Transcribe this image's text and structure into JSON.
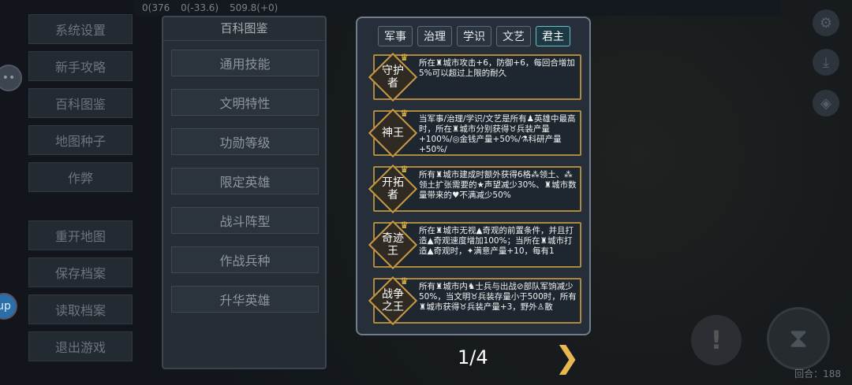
{
  "topbar": {
    "stat1": "0(376",
    "stat2": "0(-33.6)",
    "stat3": "509.8(+0)"
  },
  "left_menu": {
    "group1": [
      "系统设置",
      "新手攻略",
      "百科图鉴",
      "地图种子",
      "作弊"
    ],
    "group2": [
      "重开地图",
      "保存档案",
      "读取档案",
      "退出游戏"
    ]
  },
  "side_badge": "up",
  "encyclopedia": {
    "title": "百科图鉴",
    "items": [
      "通用技能",
      "文明特性",
      "功勋等级",
      "限定英雄",
      "战斗阵型",
      "作战兵种",
      "升华英雄"
    ]
  },
  "card": {
    "tabs": [
      "军事",
      "治理",
      "学识",
      "文艺",
      "君主"
    ],
    "active_tab": "君主",
    "traits": [
      {
        "name": "守护者",
        "desc": "所在♜城市攻击+6，防御+6，每回合增加5%可以超过上限的耐久"
      },
      {
        "name": "神王",
        "desc": "当军事/治理/学识/文艺是所有♟英雄中最高时，所在♜城市分别获得♉兵装产量+100%/◎金钱产量+50%/⚗科研产量+50%/"
      },
      {
        "name": "开拓者",
        "desc": "所有♜城市建成时额外获得6格⁂领土、⁂领土扩张需要的★声望减少30%、♜城市数量带来的♥不满减少50%"
      },
      {
        "name": "奇迹王",
        "desc": "所在♜城市无视▲奇观的前置条件，并且打造▲奇观速度增加100%；当所在♜城市打造▲奇观时，✦满意产量+10，每有1"
      },
      {
        "name": "战争之王",
        "desc": "所有♜城市内♞士兵与出战⊘部队军饷减少50%，当文明♉兵装存量小于500时，所有♜城市获得♉兵装产量+3，野外♙散"
      }
    ]
  },
  "pager": "1/4",
  "turn_label": "回合：188",
  "colors": {
    "accent_gold": "#b08a3c",
    "tab_active": "#66c0c4"
  }
}
